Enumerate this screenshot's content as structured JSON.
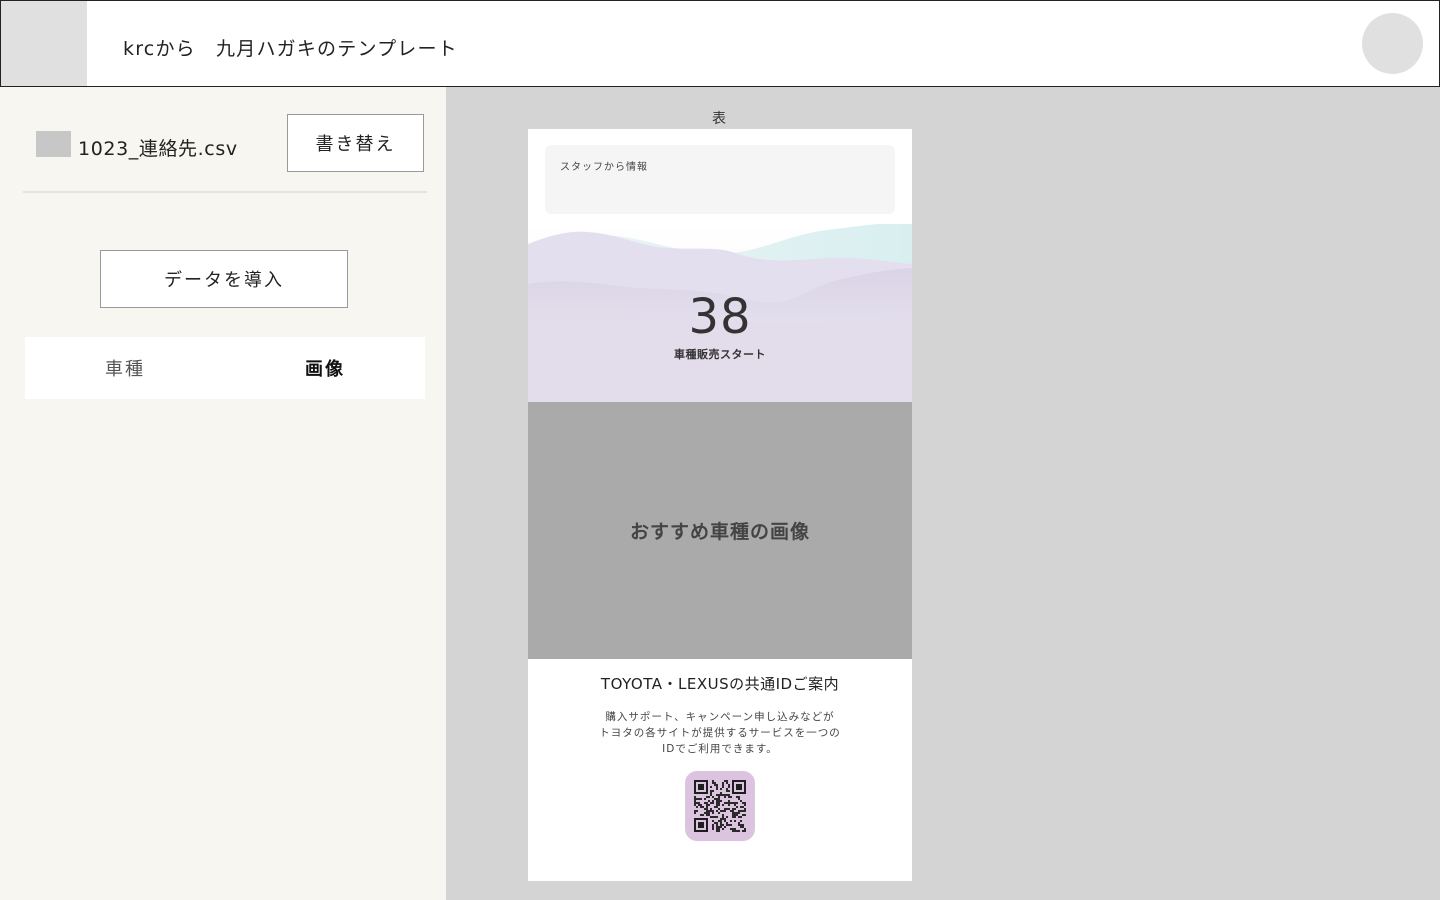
{
  "header": {
    "title": "krcから　九月ハガキのテンプレート"
  },
  "sidebar": {
    "file_name": "1023_連絡先.csv",
    "rewrite_label": "書き替え",
    "import_label": "データを導入",
    "tabs": [
      {
        "label": "車種",
        "active": false
      },
      {
        "label": "画像",
        "active": true
      }
    ]
  },
  "preview": {
    "side_label": "表",
    "staff_info": "スタッフから情報",
    "number": "38",
    "sale_label": "車種販売スタート",
    "image_placeholder": "おすすめ車種の画像",
    "id_title": "TOYOTA・LEXUSの共通IDご案内",
    "id_lines": [
      "購入サポート、キャンペーン申し込みなどが",
      "トヨタの各サイトが提供するサービスを一つの",
      "IDでご利用できます。"
    ]
  },
  "colors": {
    "sidebar_bg": "#f8f6f1",
    "canvas_bg": "#d4d4d4",
    "hero_lavender": "#e2dcea",
    "hero_mint": "#dff1f1",
    "qr_bg": "#dcc3df"
  },
  "icons": {
    "logo": "app-logo",
    "avatar": "user-avatar",
    "file": "csv-file-icon",
    "qr": "qr-code"
  }
}
